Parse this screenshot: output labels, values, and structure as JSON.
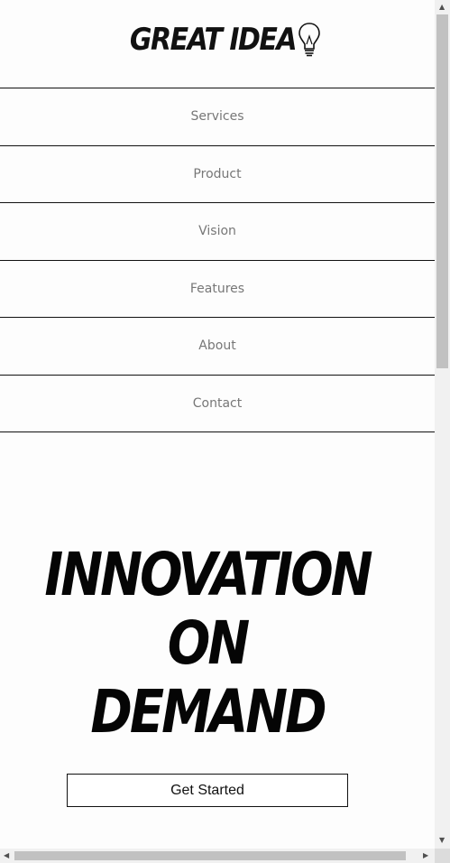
{
  "header": {
    "logo_text": "GREAT IDEA",
    "logo_icon": "lightbulb-icon"
  },
  "nav": {
    "items": [
      {
        "label": "Services"
      },
      {
        "label": "Product"
      },
      {
        "label": "Vision"
      },
      {
        "label": "Features"
      },
      {
        "label": "About"
      },
      {
        "label": "Contact"
      }
    ]
  },
  "hero": {
    "lines": [
      "INNOVATION",
      "ON",
      "DEMAND"
    ],
    "cta_label": "Get Started"
  },
  "scrollbars": {
    "up_icon": "scroll-up-arrow-icon",
    "down_icon": "scroll-down-arrow-icon",
    "left_icon": "scroll-left-arrow-icon",
    "right_icon": "scroll-right-arrow-icon"
  },
  "colors": {
    "background": "#fdfdfd",
    "text": "#111111",
    "nav_text": "#777777",
    "scroll_track": "#f1f1f1",
    "scroll_thumb": "#c1c1c1"
  }
}
